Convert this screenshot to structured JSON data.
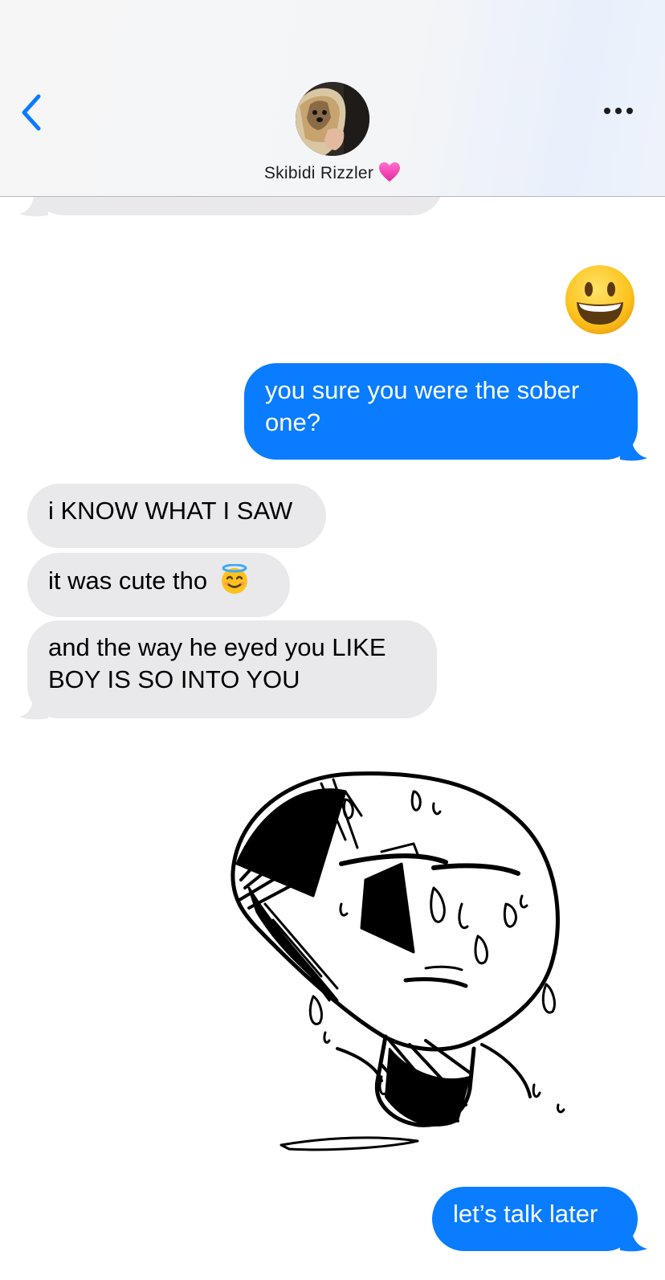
{
  "header": {
    "contact_name": "Skibidi Rizzler",
    "name_badge_icon": "pink-heart-icon",
    "back_icon": "chevron-left-icon",
    "more_icon": "ellipsis-icon",
    "accent_color": "#0a7cff"
  },
  "messages": [
    {
      "direction": "sent",
      "type": "emoji",
      "content": "grinning-face-emoji"
    },
    {
      "direction": "sent",
      "type": "text",
      "line1": "you sure you were the sober",
      "line2": "one?"
    },
    {
      "direction": "received",
      "type": "text",
      "text": "i KNOW WHAT I SAW"
    },
    {
      "direction": "received",
      "type": "text",
      "text": "it was cute tho",
      "emoji": "smiling-face-with-halo-emoji"
    },
    {
      "direction": "received",
      "type": "text",
      "line1": "and the way he eyed you LIKE",
      "line2": "BOY IS SO INTO YOU"
    },
    {
      "direction": "received",
      "type": "image",
      "content": "sweating-cartoon-face-drawing"
    },
    {
      "direction": "sent",
      "type": "text",
      "text": "let’s talk later"
    }
  ],
  "colors": {
    "sent_bubble": "#0a7cff",
    "received_bubble": "#e9e9eb"
  }
}
